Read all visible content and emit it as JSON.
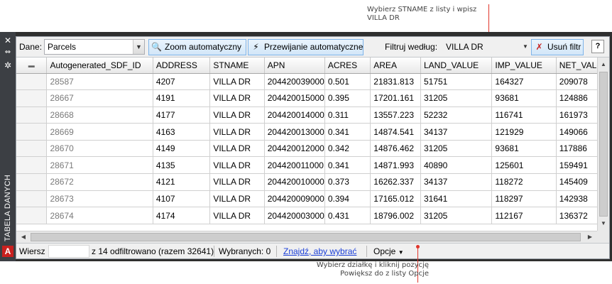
{
  "callouts": {
    "top": "Wybierz STNAME z listy i wpisz VILLA DR",
    "bottom": "Wybierz działkę i kliknij pozycję Powiększ do z listy Opcje"
  },
  "sidebar": {
    "title": "TABELA DANYCH",
    "close_icon": "close-icon",
    "pin_icon": "auto-hide-icon",
    "gear_icon": "gear-icon",
    "logo": "A"
  },
  "toolbar": {
    "data_label": "Dane:",
    "data_value": "Parcels",
    "zoom_label": "Zoom automatyczny",
    "scroll_label": "Przewijanie automatyczne",
    "filter_label": "Filtruj według:",
    "filter_value": "VILLA DR",
    "clear_label": "Usuń filtr",
    "help_label": "?"
  },
  "table": {
    "columns": [
      "Autogenerated_SDF_ID",
      "ADDRESS",
      "STNAME",
      "APN",
      "ACRES",
      "AREA",
      "LAND_VALUE",
      "IMP_VALUE",
      "NET_VALUE"
    ],
    "rows": [
      [
        "28587",
        "4207",
        "VILLA DR",
        "204420039000",
        "0.501",
        "21831.813",
        "51751",
        "164327",
        "209078"
      ],
      [
        "28667",
        "4191",
        "VILLA DR",
        "204420015000",
        "0.395",
        "17201.161",
        "31205",
        "93681",
        "124886"
      ],
      [
        "28668",
        "4177",
        "VILLA DR",
        "204420014000",
        "0.311",
        "13557.223",
        "52232",
        "116741",
        "161973"
      ],
      [
        "28669",
        "4163",
        "VILLA DR",
        "204420013000",
        "0.341",
        "14874.541",
        "34137",
        "121929",
        "149066"
      ],
      [
        "28670",
        "4149",
        "VILLA DR",
        "204420012000",
        "0.342",
        "14876.462",
        "31205",
        "93681",
        "117886"
      ],
      [
        "28671",
        "4135",
        "VILLA DR",
        "204420011000",
        "0.341",
        "14871.993",
        "40890",
        "125601",
        "159491"
      ],
      [
        "28672",
        "4121",
        "VILLA DR",
        "204420010000",
        "0.373",
        "16262.337",
        "34137",
        "118272",
        "145409"
      ],
      [
        "28673",
        "4107",
        "VILLA DR",
        "204420009000",
        "0.394",
        "17165.012",
        "31641",
        "118297",
        "142938"
      ],
      [
        "28674",
        "4174",
        "VILLA DR",
        "204420003000",
        "0.431",
        "18796.002",
        "31205",
        "112167",
        "136372"
      ]
    ]
  },
  "status": {
    "row_label": "Wiersz",
    "filtered_text": "z 14 odfiltrowano (razem 32641)",
    "selected_text": "Wybranych: 0",
    "find_link": "Znajdź, aby wybrać",
    "options_label": "Opcje"
  }
}
